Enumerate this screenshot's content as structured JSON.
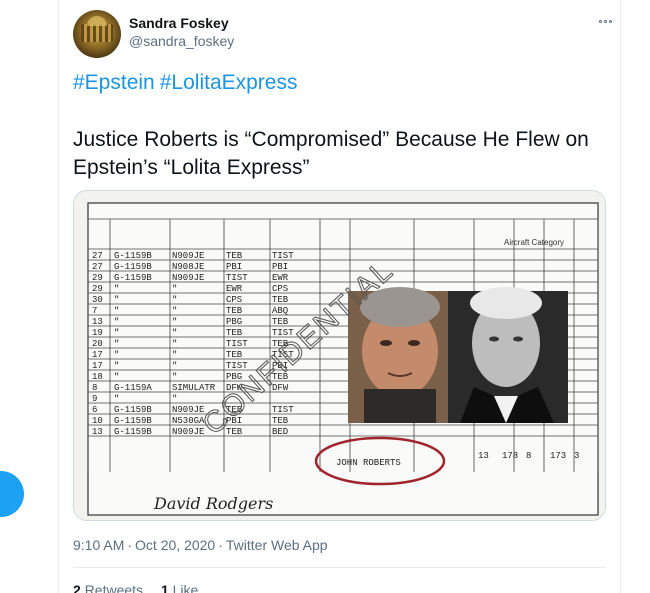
{
  "author": {
    "display_name": "Sandra Foskey",
    "handle": "@sandra_foskey"
  },
  "tweet": {
    "hashtags": [
      "#Epstein",
      "#LolitaExpress"
    ],
    "text": "Justice Roberts is “Compromised” Because He Flew on Epstein’s “Lolita Express”",
    "time": "9:10 AM",
    "date": "Oct 20, 2020",
    "source": "Twitter Web App",
    "separator": "·"
  },
  "stats": {
    "retweets_count": "2",
    "retweets_label": "Retweets",
    "likes_count": "1",
    "likes_label": "Like"
  },
  "image": {
    "stamp": "CONFIDENTIAL",
    "circled_name": "JOHN ROBERTS",
    "signature": "David Rodgers",
    "aircraft_category_header": "Aircraft Category",
    "rows": [
      {
        "date": "27",
        "aircraft": "G-1159B",
        "ident": "N909JE",
        "from": "TEB",
        "to": "TIST"
      },
      {
        "date": "27",
        "aircraft": "G-1159B",
        "ident": "N908JE",
        "from": "PBI",
        "to": "PBI"
      },
      {
        "date": "29",
        "aircraft": "G-1159B",
        "ident": "N909JE",
        "from": "TIST",
        "to": "EWR"
      },
      {
        "date": "29",
        "aircraft": "\"",
        "ident": "\"",
        "from": "EWR",
        "to": "CPS"
      },
      {
        "date": "30",
        "aircraft": "\"",
        "ident": "\"",
        "from": "CPS",
        "to": "TEB"
      },
      {
        "date": "7",
        "aircraft": "\"",
        "ident": "\"",
        "from": "TEB",
        "to": "ABQ"
      },
      {
        "date": "13",
        "aircraft": "\"",
        "ident": "\"",
        "from": "PBG",
        "to": "TEB"
      },
      {
        "date": "19",
        "aircraft": "\"",
        "ident": "\"",
        "from": "TEB",
        "to": "TIST"
      },
      {
        "date": "20",
        "aircraft": "\"",
        "ident": "\"",
        "from": "TIST",
        "to": "TEB"
      },
      {
        "date": "17",
        "aircraft": "\"",
        "ident": "\"",
        "from": "TEB",
        "to": "TIST"
      },
      {
        "date": "17",
        "aircraft": "\"",
        "ident": "\"",
        "from": "TIST",
        "to": "PBI"
      },
      {
        "date": "18",
        "aircraft": "\"",
        "ident": "\"",
        "from": "PBG",
        "to": "TEB"
      },
      {
        "date": "8",
        "aircraft": "G-1159A",
        "ident": "SIMULATR",
        "from": "DFW",
        "to": "DFW"
      },
      {
        "date": "9",
        "aircraft": "\"",
        "ident": "\"",
        "from": "",
        "to": ""
      },
      {
        "date": "6",
        "aircraft": "G-1159B",
        "ident": "N909JE",
        "from": "TEB",
        "to": "TIST"
      },
      {
        "date": "10",
        "aircraft": "G-1159B",
        "ident": "N530GA",
        "from": "PBI",
        "to": "TEB"
      },
      {
        "date": "13",
        "aircraft": "G-1159B",
        "ident": "N909JE",
        "from": "TEB",
        "to": "BED"
      }
    ],
    "totals": [
      "13",
      "178",
      "8",
      "173",
      "3"
    ]
  }
}
